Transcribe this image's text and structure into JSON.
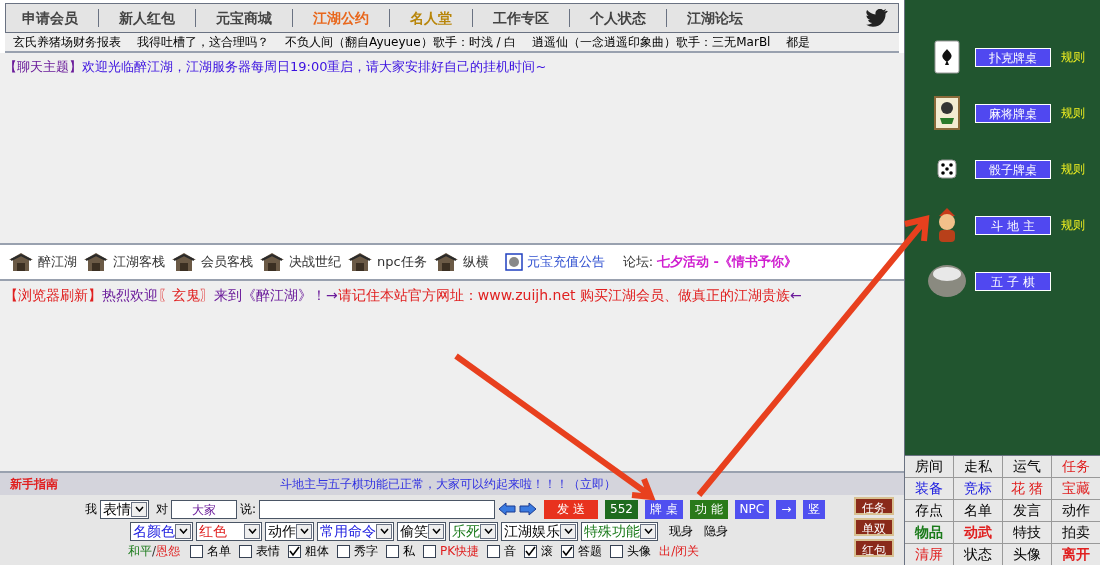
{
  "nav": [
    {
      "label": "申请会员",
      "color": "#444444"
    },
    {
      "label": "新人红包",
      "color": "#444444"
    },
    {
      "label": "元宝商城",
      "color": "#444444"
    },
    {
      "label": "江湖公约",
      "color": "#e8671c"
    },
    {
      "label": "名人堂",
      "color": "#b8860b"
    },
    {
      "label": "工作专区",
      "color": "#444444"
    },
    {
      "label": "个人状态",
      "color": "#444444"
    },
    {
      "label": "江湖论坛",
      "color": "#444444"
    }
  ],
  "ticker": [
    "玄氏养猪场财务报表",
    "我得吐槽了，这合理吗？",
    "不负人间（翻自Ayueyue）歌手：时浅 / 白",
    "逍遥仙（一念逍遥印象曲）歌手：三无MarBl",
    "都是"
  ],
  "chat_topic": {
    "tag": "【聊天主题】",
    "text": "欢迎光临醉江湖，江湖服务器每周日19:00重启，请大家安排好自己的挂机时间~"
  },
  "links": [
    "醉江湖",
    "江湖客栈",
    "会员客栈",
    "决战世纪",
    "npc任务",
    "纵横"
  ],
  "notice_link": "元宝充值公告",
  "forum": {
    "label": "论坛:",
    "link": "七夕活动 -《情书予你》"
  },
  "system_message": [
    {
      "text": "【浏览器刷新】",
      "color": "#e02020"
    },
    {
      "text": "热烈欢迎",
      "color": "#6a1b9a"
    },
    {
      "text": "〖玄鬼〗",
      "color": "#e02020"
    },
    {
      "text": "来到《醉江湖》！→",
      "color": "#6a1b9a"
    },
    {
      "text": "请记住本站官方网址：www.zuijh.net 购买江湖会员、做真正的江湖贵族",
      "color": "#e02020"
    },
    {
      "text": "←",
      "color": "#6a1b9a"
    }
  ],
  "guide": {
    "title": "新手指南",
    "notice": "斗地主与五子棋功能已正常，大家可以约起来啦！！！（立即）"
  },
  "composer": {
    "me": "我",
    "mood": "表情",
    "to": "对",
    "target": "大家",
    "say": "说:",
    "buttons": [
      {
        "label": "发 送",
        "color": "#e8321e"
      },
      {
        "label": "552",
        "color": "#1e6b1e"
      },
      {
        "label": "牌 桌",
        "color": "#5050f0"
      },
      {
        "label": "功 能",
        "color": "#2a7a1a"
      },
      {
        "label": "NPC",
        "color": "#5050f0"
      },
      {
        "label": "→",
        "color": "#5050f0"
      },
      {
        "label": "竖",
        "color": "#5050f0"
      }
    ]
  },
  "selects": [
    {
      "value": "名颜色",
      "color": "#2020e0"
    },
    {
      "value": "红色",
      "color": "#e02020"
    },
    {
      "value": "动作"
    },
    {
      "value": "常用命令",
      "color": "#2020e0"
    },
    {
      "value": "偷笑"
    },
    {
      "value": "乐死",
      "color": "#1a7a1a"
    },
    {
      "value": "江湖娱乐"
    },
    {
      "value": "特殊功能",
      "color": "#1a7a1a"
    }
  ],
  "presence": [
    "现身",
    "隐身"
  ],
  "peace": {
    "left": "和平",
    "sep": "/",
    "right": "恩怨"
  },
  "options": [
    {
      "label": "名单",
      "checked": false
    },
    {
      "label": "表情",
      "checked": false
    },
    {
      "label": "粗体",
      "checked": true
    },
    {
      "label": "秀字",
      "checked": false
    },
    {
      "label": "私",
      "checked": false
    },
    {
      "label": "PK快捷",
      "checked": false
    },
    {
      "label": "音",
      "checked": false
    },
    {
      "label": "滚",
      "checked": true
    },
    {
      "label": "答题",
      "checked": true
    },
    {
      "label": "头像",
      "checked": false
    }
  ],
  "exit_link": "出/闭关",
  "side_buttons": [
    "任务",
    "单双",
    "红包"
  ],
  "games": [
    {
      "label": "扑克牌桌",
      "rules": "规则",
      "kind": "card"
    },
    {
      "label": "麻将牌桌",
      "rules": "规则",
      "kind": "mahjong"
    },
    {
      "label": "骰子牌桌",
      "rules": "规则",
      "kind": "dice"
    },
    {
      "label": "斗 地 主",
      "rules": "规则",
      "kind": "landlord"
    },
    {
      "label": "五 子 棋",
      "kind": "go"
    }
  ],
  "grid": [
    [
      {
        "label": "房间"
      },
      {
        "label": "走私"
      },
      {
        "label": "运气"
      },
      {
        "label": "任务",
        "color": "#e02020"
      }
    ],
    [
      {
        "label": "装备",
        "color": "#2020e0"
      },
      {
        "label": "竞标",
        "color": "#2020e0"
      },
      {
        "label": "花 猪",
        "color": "#e02020"
      },
      {
        "label": "宝藏",
        "color": "#e02020"
      }
    ],
    [
      {
        "label": "存点"
      },
      {
        "label": "名单"
      },
      {
        "label": "发言"
      },
      {
        "label": "动作"
      }
    ],
    [
      {
        "label": "物品",
        "color": "#1a7a1a",
        "bold": true
      },
      {
        "label": "动武",
        "color": "#e02020",
        "bold": true
      },
      {
        "label": "特技"
      },
      {
        "label": "拍卖"
      }
    ],
    [
      {
        "label": "清屏",
        "color": "#e02020"
      },
      {
        "label": "状态"
      },
      {
        "label": "头像"
      },
      {
        "label": "离开",
        "color": "#e02020",
        "bold": true
      }
    ]
  ]
}
